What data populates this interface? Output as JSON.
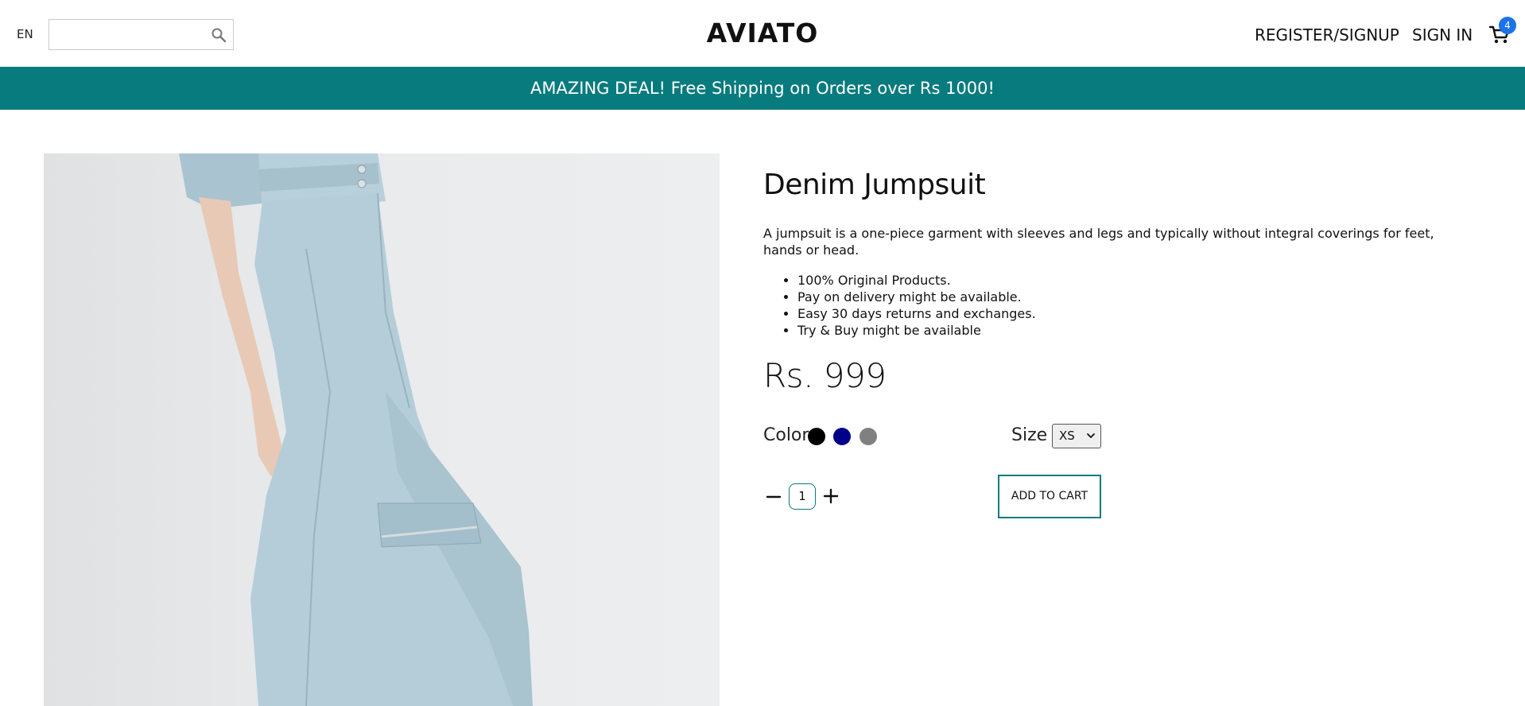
{
  "header": {
    "language": "EN",
    "search": {
      "value": "",
      "placeholder": ""
    },
    "brand": "AVIATO",
    "register_label": "REGISTER/SIGNUP",
    "signin_label": "SIGN IN",
    "cart_count": "4"
  },
  "promo": {
    "text": "AMAZING DEAL! Free Shipping on Orders over Rs 1000!"
  },
  "product": {
    "title": "Denim Jumpsuit",
    "description": "A jumpsuit is a one-piece garment with sleeves and legs and typically without integral coverings for feet, hands or head.",
    "features": [
      "100% Original Products.",
      "Pay on delivery might be available.",
      "Easy 30 days returns and exchanges.",
      "Try & Buy might be available"
    ],
    "price": "Rs. 999",
    "color_label": "Color",
    "colors": [
      "#000000",
      "#00008b",
      "#808080"
    ],
    "size_label": "Size",
    "size_selected": "XS",
    "quantity": "1",
    "add_to_cart_label": "ADD TO CART"
  },
  "colors": {
    "accent": "#087b7e",
    "badge": "#1a73e8"
  }
}
